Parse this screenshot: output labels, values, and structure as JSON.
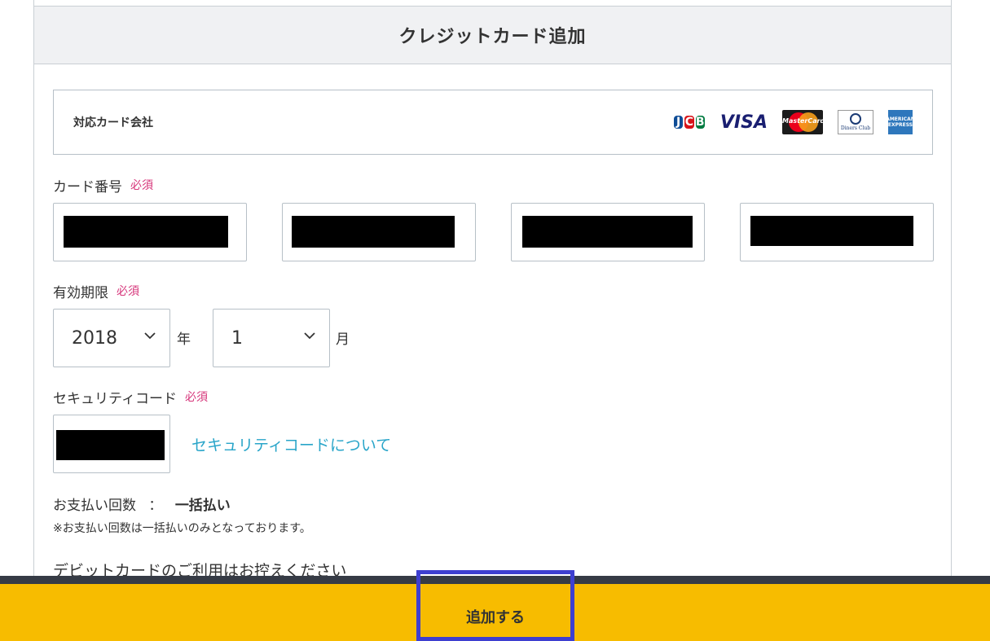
{
  "header": {
    "title": "クレジットカード追加"
  },
  "supported_cards": {
    "label": "対応カード会社",
    "brands": {
      "jcb": [
        "J",
        "C",
        "B"
      ],
      "visa": "VISA",
      "mastercard": "MasterCard",
      "diners": "Diners Club",
      "amex": "AMERICAN EXPRESS"
    }
  },
  "card_number": {
    "label": "カード番号",
    "required": "必須"
  },
  "expiry": {
    "label": "有効期限",
    "required": "必須",
    "year": "2018",
    "year_unit": "年",
    "month": "1",
    "month_unit": "月"
  },
  "security_code": {
    "label": "セキュリティコード",
    "required": "必須",
    "help_link": "セキュリティコードについて"
  },
  "payment": {
    "label": "お支払い回数",
    "separator": "：",
    "value": "一括払い",
    "note": "※お支払い回数は一括払いのみとなっております。"
  },
  "debit_notice": "デビットカードのご利用はお控えください",
  "footer": {
    "submit_label": "追加する"
  },
  "colors": {
    "accent_yellow": "#f7bc00",
    "required_pink": "#d6357a",
    "link_blue": "#29a5c9",
    "focus_border": "#3e3fd0"
  }
}
